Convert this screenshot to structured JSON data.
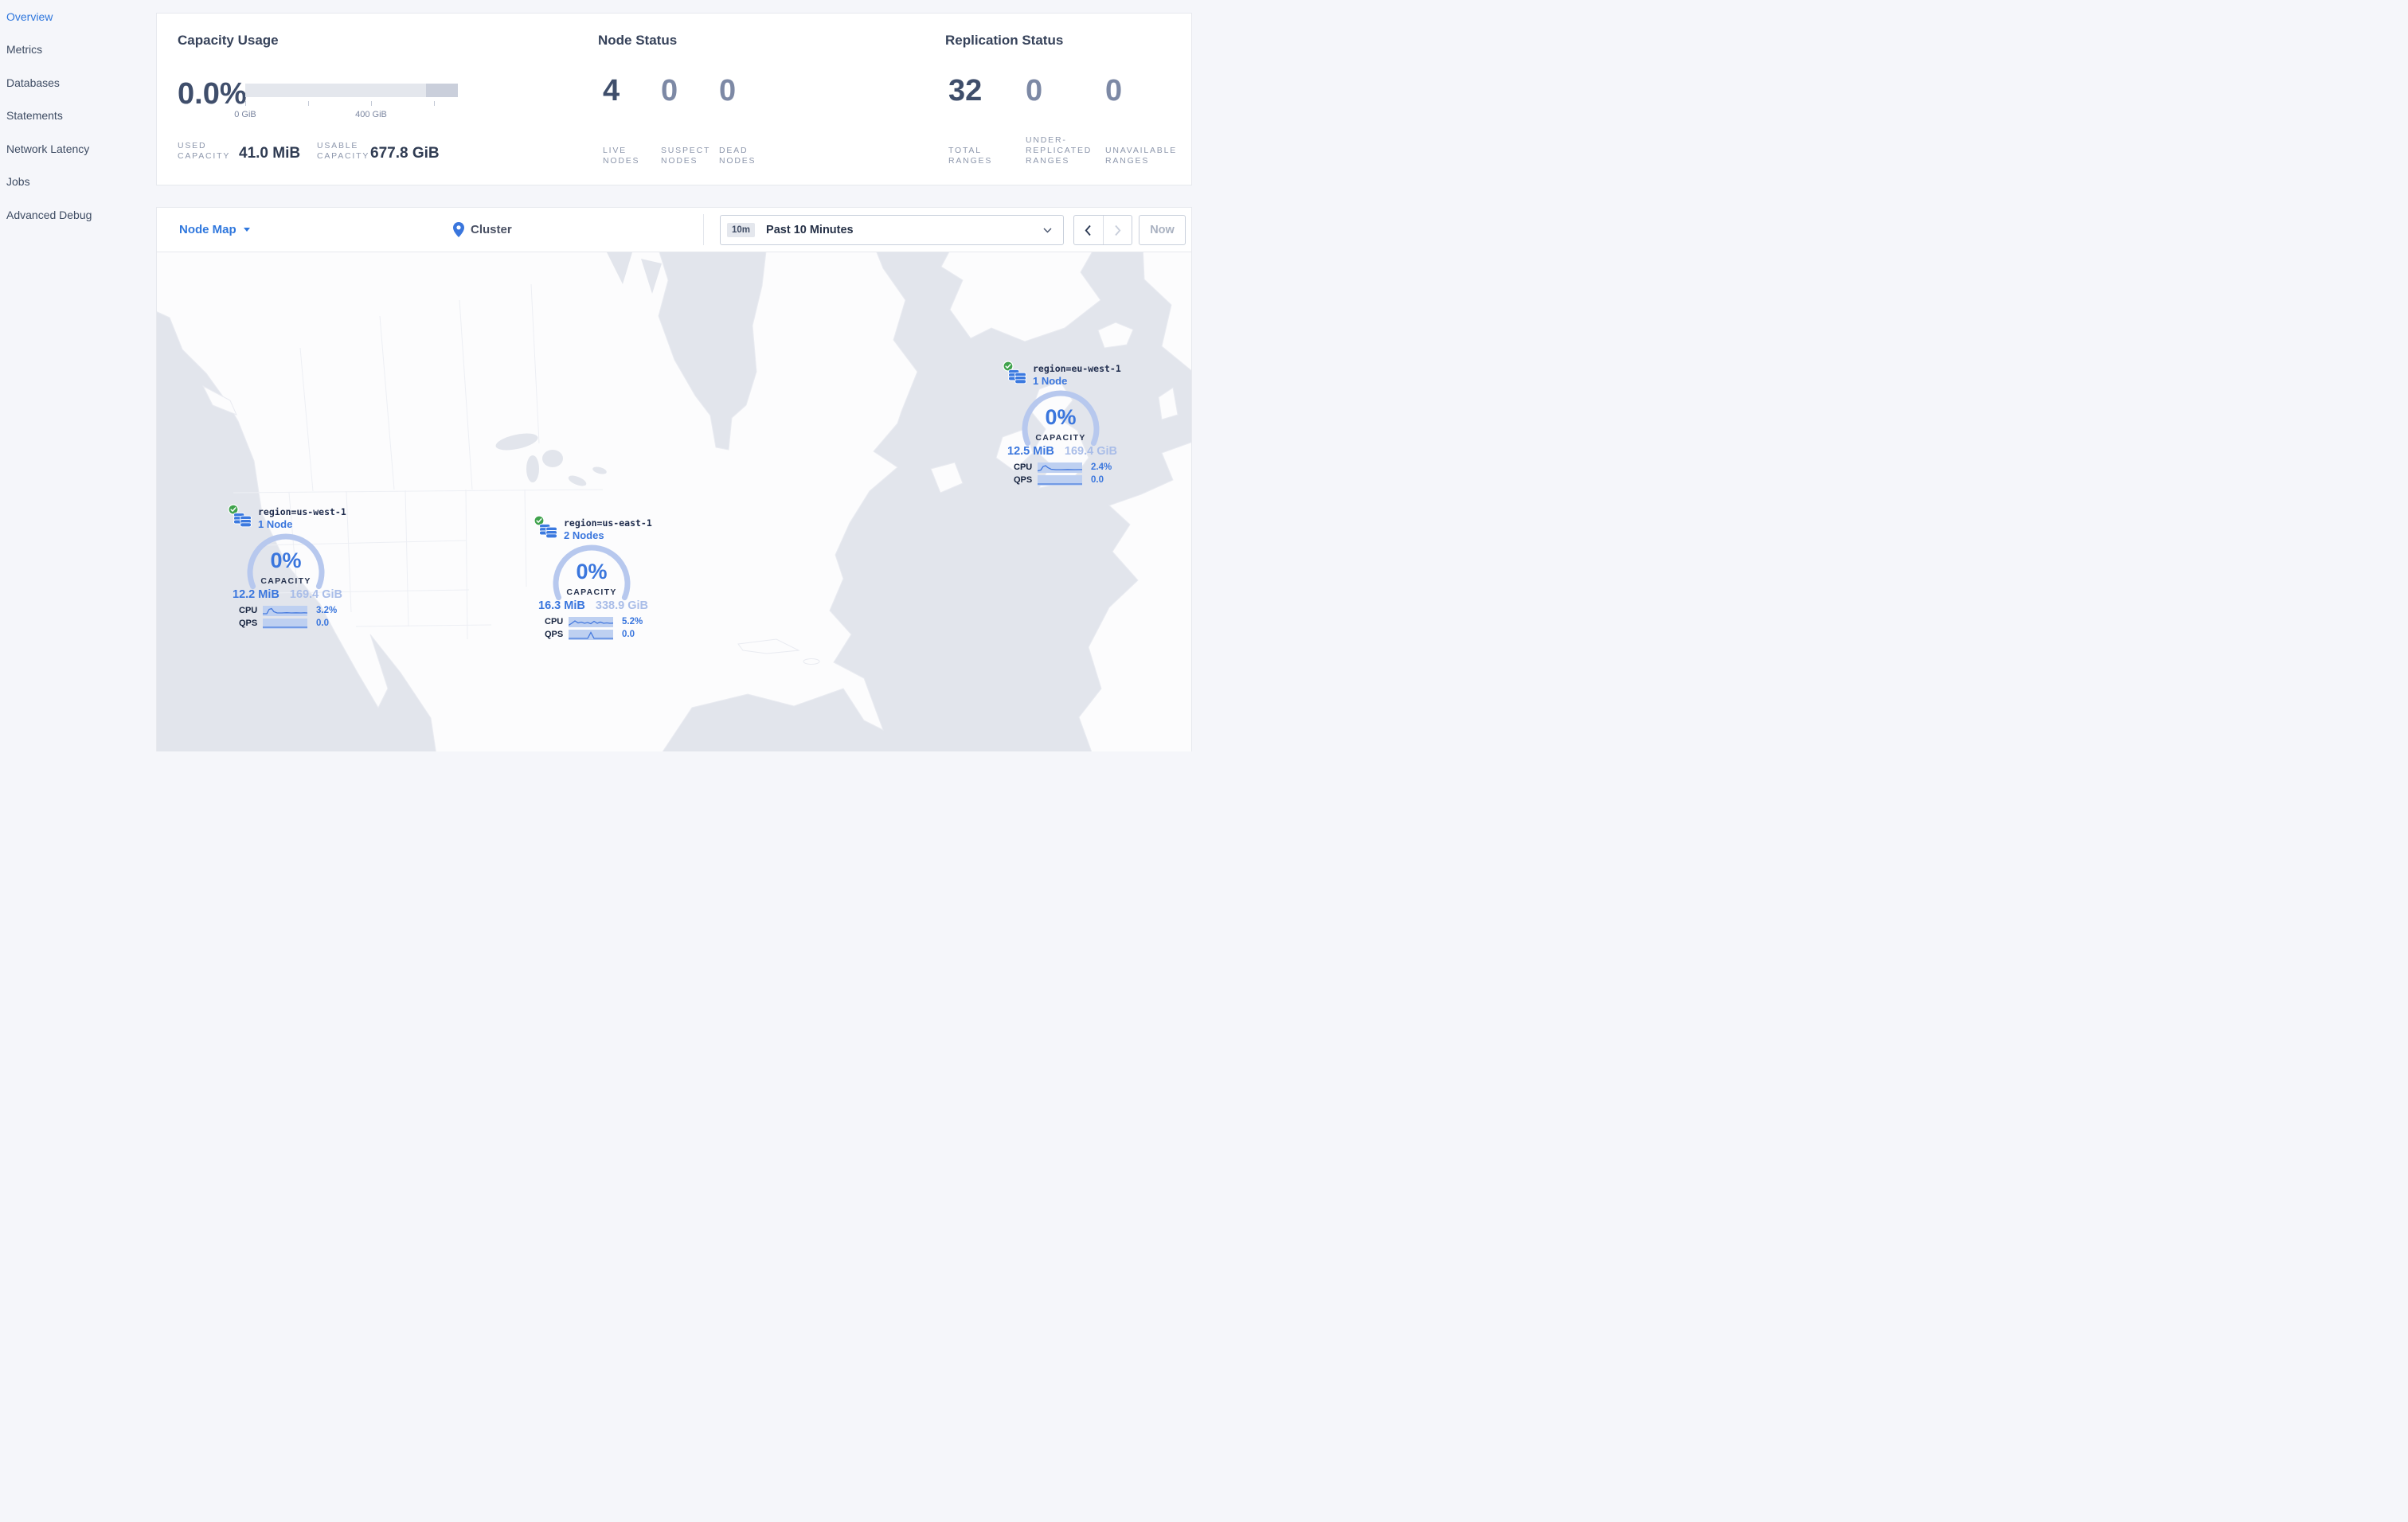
{
  "sidebar": {
    "items": [
      {
        "label": "Overview",
        "active": true
      },
      {
        "label": "Metrics"
      },
      {
        "label": "Databases"
      },
      {
        "label": "Statements"
      },
      {
        "label": "Network Latency"
      },
      {
        "label": "Jobs"
      },
      {
        "label": "Advanced Debug"
      }
    ]
  },
  "stats": {
    "capacity": {
      "title": "Capacity Usage",
      "percent": "0.0%",
      "tick_start": "0 GiB",
      "tick_mid": "400 GiB",
      "used_label": "USED CAPACITY",
      "used_value": "41.0 MiB",
      "usable_label": "USABLE CAPACITY",
      "usable_value": "677.8 GiB"
    },
    "node_status": {
      "title": "Node Status",
      "items": [
        {
          "value": "4",
          "label": "LIVE NODES"
        },
        {
          "value": "0",
          "label": "SUSPECT NODES"
        },
        {
          "value": "0",
          "label": "DEAD NODES"
        }
      ]
    },
    "replication": {
      "title": "Replication Status",
      "items": [
        {
          "value": "32",
          "label": "TOTAL RANGES"
        },
        {
          "value": "0",
          "label": "UNDER-REPLICATED RANGES"
        },
        {
          "value": "0",
          "label": "UNAVAILABLE RANGES"
        }
      ]
    }
  },
  "toolbar": {
    "view_label": "Node Map",
    "breadcrumb": "Cluster",
    "time_badge": "10m",
    "time_label": "Past 10 Minutes",
    "now_label": "Now"
  },
  "map_nodes": [
    {
      "region": "region=us-west-1",
      "count": "1 Node",
      "percent": "0%",
      "capacity_label": "CAPACITY",
      "used": "12.2 MiB",
      "capacity": "169.4 GiB",
      "cpu_label": "CPU",
      "cpu": "3.2%",
      "qps_label": "QPS",
      "qps": "0.0"
    },
    {
      "region": "region=us-east-1",
      "count": "2 Nodes",
      "percent": "0%",
      "capacity_label": "CAPACITY",
      "used": "16.3 MiB",
      "capacity": "338.9 GiB",
      "cpu_label": "CPU",
      "cpu": "5.2%",
      "qps_label": "QPS",
      "qps": "0.0"
    },
    {
      "region": "region=eu-west-1",
      "count": "1 Node",
      "percent": "0%",
      "capacity_label": "CAPACITY",
      "used": "12.5 MiB",
      "capacity": "169.4 GiB",
      "cpu_label": "CPU",
      "cpu": "2.4%",
      "qps_label": "QPS",
      "qps": "0.0"
    }
  ],
  "colors": {
    "accent_blue": "#3a76dd",
    "healthy_green": "#3fa24c",
    "ocean": "#e2e5ec",
    "dark_text": "#2f3b52",
    "muted_text": "#8d97ac"
  }
}
